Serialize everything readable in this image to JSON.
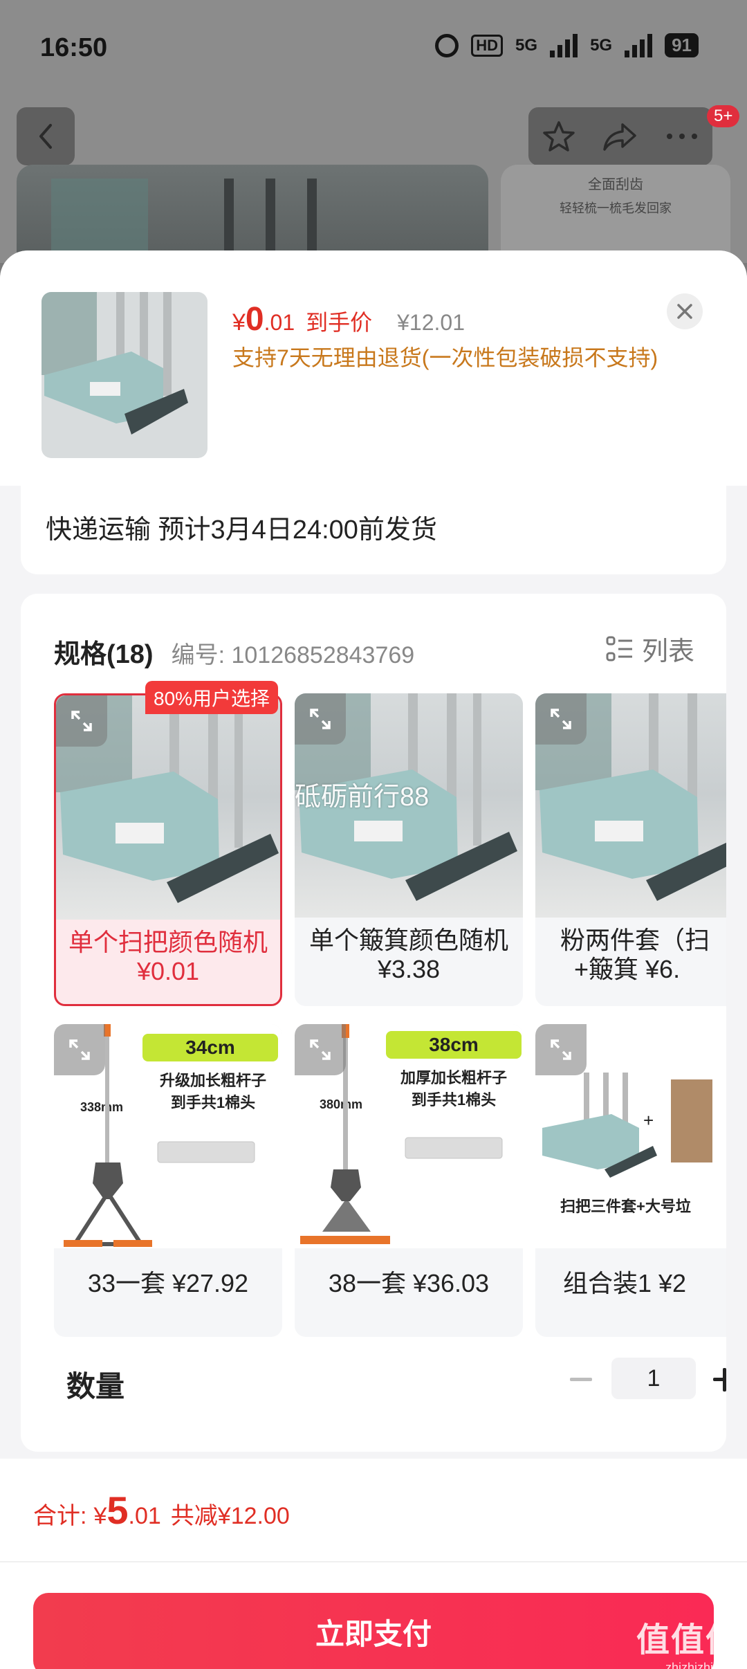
{
  "status_bar": {
    "time": "16:50",
    "network_1": "5G",
    "network_2": "5G",
    "hd": "HD",
    "battery": "91"
  },
  "nav": {
    "badge": "5+"
  },
  "background": {
    "thumb_title": "全面刮齿",
    "thumb_subtitle": "轻轻梳一梳毛发回家"
  },
  "product": {
    "price_symbol": "¥",
    "price_int": "0",
    "price_dec": ".01",
    "price_label": "到手价",
    "original_price": "¥12.01",
    "return_note": "支持7天无理由退货(一次性包装破损不支持)"
  },
  "shipping": {
    "text": "快递运输 预计3月4日24:00前发货"
  },
  "spec": {
    "title": "规格(18)",
    "code": "编号: 10126852843769",
    "view_toggle": "列表",
    "popular_tag": "80%用户选择",
    "watermark": "砥砺前行88",
    "options": [
      {
        "line1": "单个扫把颜色随机",
        "line2": "¥0.01",
        "selected": true
      },
      {
        "line1": "单个簸箕颜色随机",
        "line2": "¥3.38",
        "selected": false
      },
      {
        "line1": "粉两件套（扫",
        "line2": "+簸箕 ¥6.",
        "selected": false
      },
      {
        "line1": "33一套 ¥27.92",
        "img_tag": "34cm",
        "img_text1": "升级加长粗杆子",
        "img_text2": "到手共1棉头",
        "img_size": "338mm"
      },
      {
        "line1": "38一套 ¥36.03",
        "img_tag": "38cm",
        "img_text1": "加厚加长粗杆子",
        "img_text2": "到手共1棉头",
        "img_size": "380mm"
      },
      {
        "line1": "组合装1 ¥2",
        "img_text1": "扫把三件套+大号垃",
        "img_plus": "+"
      }
    ]
  },
  "quantity": {
    "label": "数量",
    "value": "1"
  },
  "footer": {
    "total_label": "合计:",
    "total_symbol": "¥",
    "total_int": "5",
    "total_dec": ".01",
    "total_saved": "共减¥12.00",
    "pay_button": "立即支付"
  },
  "site_mark": {
    "big": "值值值",
    "small": "zhizhizhi.com"
  },
  "colors": {
    "accent_red": "#e02e24",
    "button_red": "#f23c4e",
    "return_orange": "#c8781c",
    "tag_green": "#c4e634"
  }
}
